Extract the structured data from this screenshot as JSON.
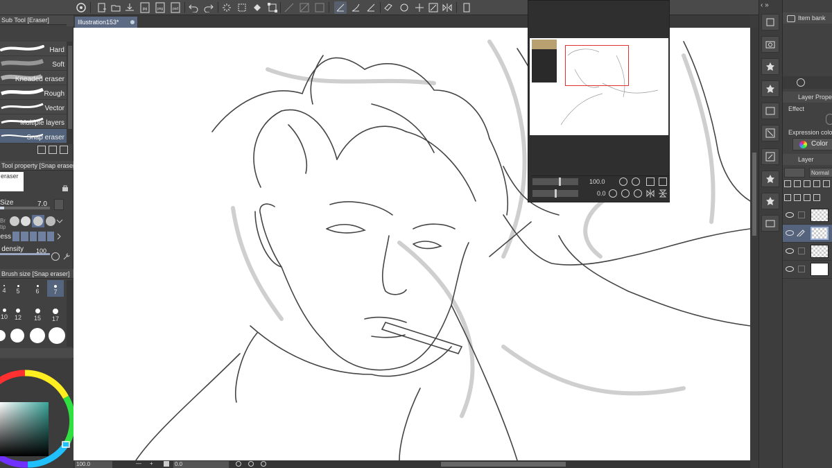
{
  "toolbar": {
    "icons": [
      "app-logo-icon",
      "new-file-icon",
      "open-file-icon",
      "save-icon",
      "export-jpg-icon",
      "export-png-icon",
      "export-psd-icon",
      "undo-icon",
      "redo-icon",
      "loading-icon",
      "select-all-icon",
      "fill-icon",
      "transform-icon",
      "snap-off-icon",
      "ruler-icon",
      "grid-icon",
      "snap-ruler-icon",
      "snap-special-icon",
      "snap-grid-icon",
      "edit-icon",
      "move-icon",
      "rotate-icon",
      "flip-icon",
      "tablet-icon"
    ],
    "export_labels": [
      "jpg",
      "png",
      "psd"
    ]
  },
  "document": {
    "tab_title": "Illustration153*"
  },
  "sub_tool": {
    "title": "Sub Tool [Eraser]",
    "brushes": [
      {
        "label": "Hard",
        "selected": false
      },
      {
        "label": "Soft",
        "selected": false
      },
      {
        "label": "Kneaded eraser",
        "selected": false
      },
      {
        "label": "Rough",
        "selected": false
      },
      {
        "label": "Vector",
        "selected": false
      },
      {
        "label": "Multiple layers",
        "selected": false
      },
      {
        "label": "Snap eraser",
        "selected": true
      }
    ]
  },
  "tool_property": {
    "title": "Tool property [Snap eraser]",
    "preview_label": "eraser",
    "size_label": "Size",
    "size_value": "7.0",
    "tip_label": "Brush tip",
    "hardness_label": "Hardness",
    "density_label": "Brush density",
    "density_value": "100"
  },
  "brush_size": {
    "title": "Brush size [Snap eraser]",
    "rows": [
      [
        "4",
        "5",
        "6",
        "7"
      ],
      [
        "10",
        "12",
        "15",
        "17"
      ]
    ],
    "selected": "7"
  },
  "status": {
    "zoom": "100.0",
    "rotation": "0.0"
  },
  "navigator": {
    "zoom": "100.0",
    "rotation": "0.0"
  },
  "right_panel": {
    "item_bank": "Item bank",
    "layer_property": "Layer Property",
    "effect": "Effect",
    "expression_color": "Expression color",
    "color_button": "Color",
    "layer": "Layer",
    "blend_mode": "Normal"
  },
  "colors": {
    "accent": "#52627a",
    "panel": "#414141",
    "selection": "#e53030"
  }
}
